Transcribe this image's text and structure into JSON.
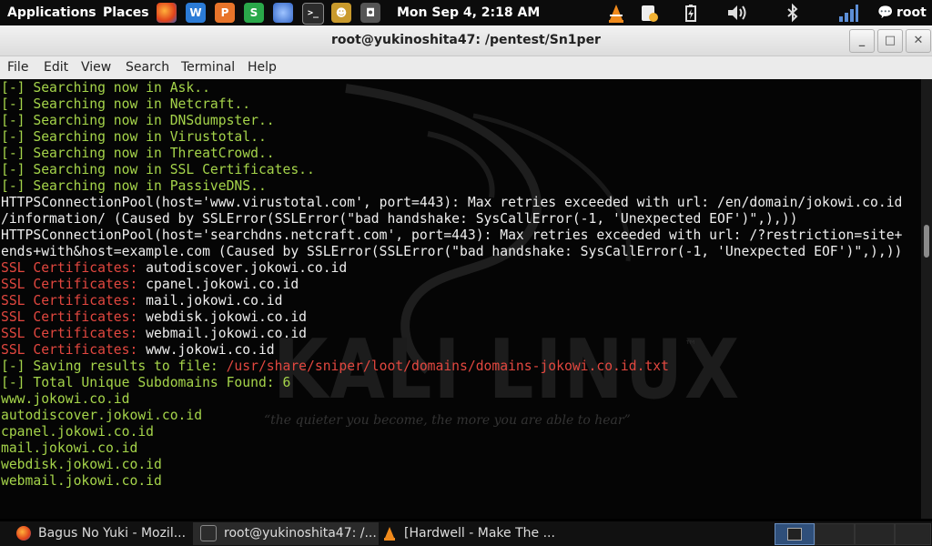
{
  "top_panel": {
    "applications": "Applications",
    "places": "Places",
    "clock": "Mon Sep  4,  2:18 AM",
    "user": "root",
    "launchers": [
      "firefox-icon",
      "writer-icon",
      "impress-icon",
      "calc-icon",
      "network-icon",
      "terminal-icon",
      "game-icon",
      "screenshot-icon"
    ],
    "tray": [
      "vlc-icon",
      "notes-icon",
      "battery-icon",
      "volume-icon",
      "bluetooth-icon",
      "signal-icon",
      "chat-icon"
    ]
  },
  "window": {
    "title": "root@yukinoshita47: /pentest/Sn1per",
    "minimize": "_",
    "maximize": "□",
    "close": "✕"
  },
  "menu": [
    "File",
    "Edit",
    "View",
    "Search",
    "Terminal",
    "Help"
  ],
  "terminal": {
    "background": {
      "logo": "KALI LINUX",
      "tm": "™",
      "tagline": "“the quieter you become, the more you are able to hear”"
    },
    "lines": [
      [
        {
          "t": "[-] Searching now in Ask..",
          "c": "g"
        }
      ],
      [
        {
          "t": "[-] Searching now in Netcraft..",
          "c": "g"
        }
      ],
      [
        {
          "t": "[-] Searching now in DNSdumpster..",
          "c": "g"
        }
      ],
      [
        {
          "t": "[-] Searching now in Virustotal..",
          "c": "g"
        }
      ],
      [
        {
          "t": "[-] Searching now in ThreatCrowd..",
          "c": "g"
        }
      ],
      [
        {
          "t": "[-] Searching now in SSL Certificates..",
          "c": "g"
        }
      ],
      [
        {
          "t": "[-] Searching now in PassiveDNS..",
          "c": "g"
        }
      ],
      [
        {
          "t": "HTTPSConnectionPool(host='www.virustotal.com', port=443): Max retries exceeded with url: /en/domain/jokowi.co.id",
          "c": "w"
        }
      ],
      [
        {
          "t": "/information/ (Caused by SSLError(SSLError(\"bad handshake: SysCallError(-1, 'Unexpected EOF')\",),))",
          "c": "w"
        }
      ],
      [
        {
          "t": "HTTPSConnectionPool(host='searchdns.netcraft.com', port=443): Max retries exceeded with url: /?restriction=site+",
          "c": "w"
        }
      ],
      [
        {
          "t": "ends+with&host=example.com (Caused by SSLError(SSLError(\"bad handshake: SysCallError(-1, 'Unexpected EOF')\",),))",
          "c": "w"
        }
      ],
      [
        {
          "t": "SSL Certificates: ",
          "c": "r"
        },
        {
          "t": "autodiscover.jokowi.co.id",
          "c": "w"
        }
      ],
      [
        {
          "t": "SSL Certificates: ",
          "c": "r"
        },
        {
          "t": "cpanel.jokowi.co.id",
          "c": "w"
        }
      ],
      [
        {
          "t": "SSL Certificates: ",
          "c": "r"
        },
        {
          "t": "mail.jokowi.co.id",
          "c": "w"
        }
      ],
      [
        {
          "t": "SSL Certificates: ",
          "c": "r"
        },
        {
          "t": "webdisk.jokowi.co.id",
          "c": "w"
        }
      ],
      [
        {
          "t": "SSL Certificates: ",
          "c": "r"
        },
        {
          "t": "webmail.jokowi.co.id",
          "c": "w"
        }
      ],
      [
        {
          "t": "SSL Certificates: ",
          "c": "r"
        },
        {
          "t": "www.jokowi.co.id",
          "c": "w"
        }
      ],
      [
        {
          "t": "[-] Saving results to file: ",
          "c": "g"
        },
        {
          "t": "/usr/share/sniper/loot/domains/domains-jokowi.co.id.txt",
          "c": "r"
        }
      ],
      [
        {
          "t": "[-] Total Unique Subdomains Found: 6",
          "c": "g"
        }
      ],
      [
        {
          "t": "www.jokowi.co.id",
          "c": "g"
        }
      ],
      [
        {
          "t": "autodiscover.jokowi.co.id",
          "c": "g"
        }
      ],
      [
        {
          "t": "cpanel.jokowi.co.id",
          "c": "g"
        }
      ],
      [
        {
          "t": "mail.jokowi.co.id",
          "c": "g"
        }
      ],
      [
        {
          "t": "webdisk.jokowi.co.id",
          "c": "g"
        }
      ],
      [
        {
          "t": "webmail.jokowi.co.id",
          "c": "g"
        }
      ]
    ]
  },
  "taskbar": {
    "tasks": [
      {
        "label": "Bagus No Yuki - Mozil...",
        "icon": "firefox-icon"
      },
      {
        "label": "root@yukinoshita47: /...",
        "icon": "terminal-icon"
      },
      {
        "label": "[Hardwell - Make The ...",
        "icon": "vlc-icon"
      }
    ]
  },
  "colors": {
    "green": "#a5d44a",
    "red": "#e2473f",
    "white": "#eeeeee"
  }
}
